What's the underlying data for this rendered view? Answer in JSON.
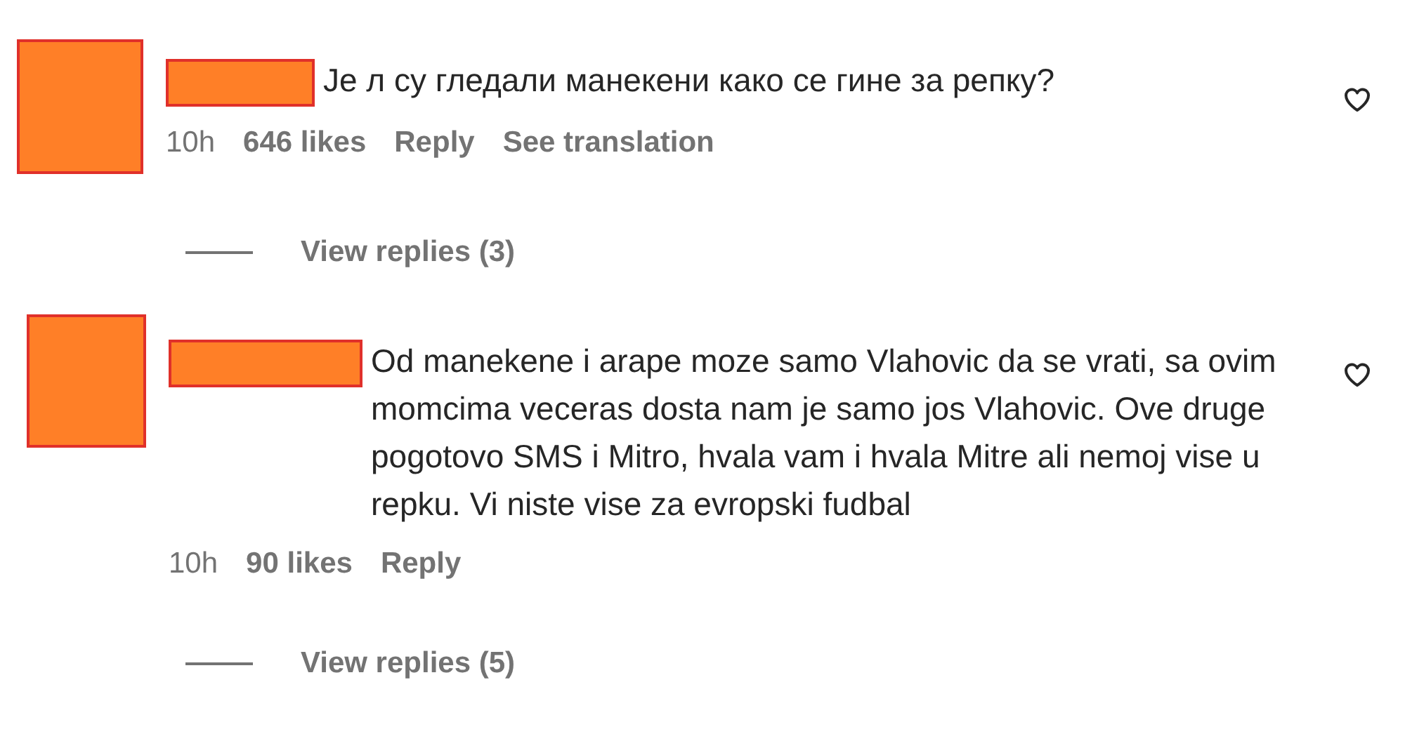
{
  "comments": [
    {
      "text": "Је л су гледали манекени како се гине за репку?",
      "time": "10h",
      "likes": "646 likes",
      "actions": [
        "Reply",
        "See translation"
      ],
      "view_replies": "View replies (3)"
    },
    {
      "text": "Od manekene i arape moze samo Vlahovic da se vrati, sa ovim momcima veceras dosta nam je samo jos Vlahovic. Ove druge pogotovo SMS i Mitro, hvala vam i hvala Mitre ali nemoj vise u repku. Vi niste vise za evropski fudbal",
      "time": "10h",
      "likes": "90 likes",
      "actions": [
        "Reply"
      ],
      "view_replies": "View replies (5)"
    }
  ]
}
